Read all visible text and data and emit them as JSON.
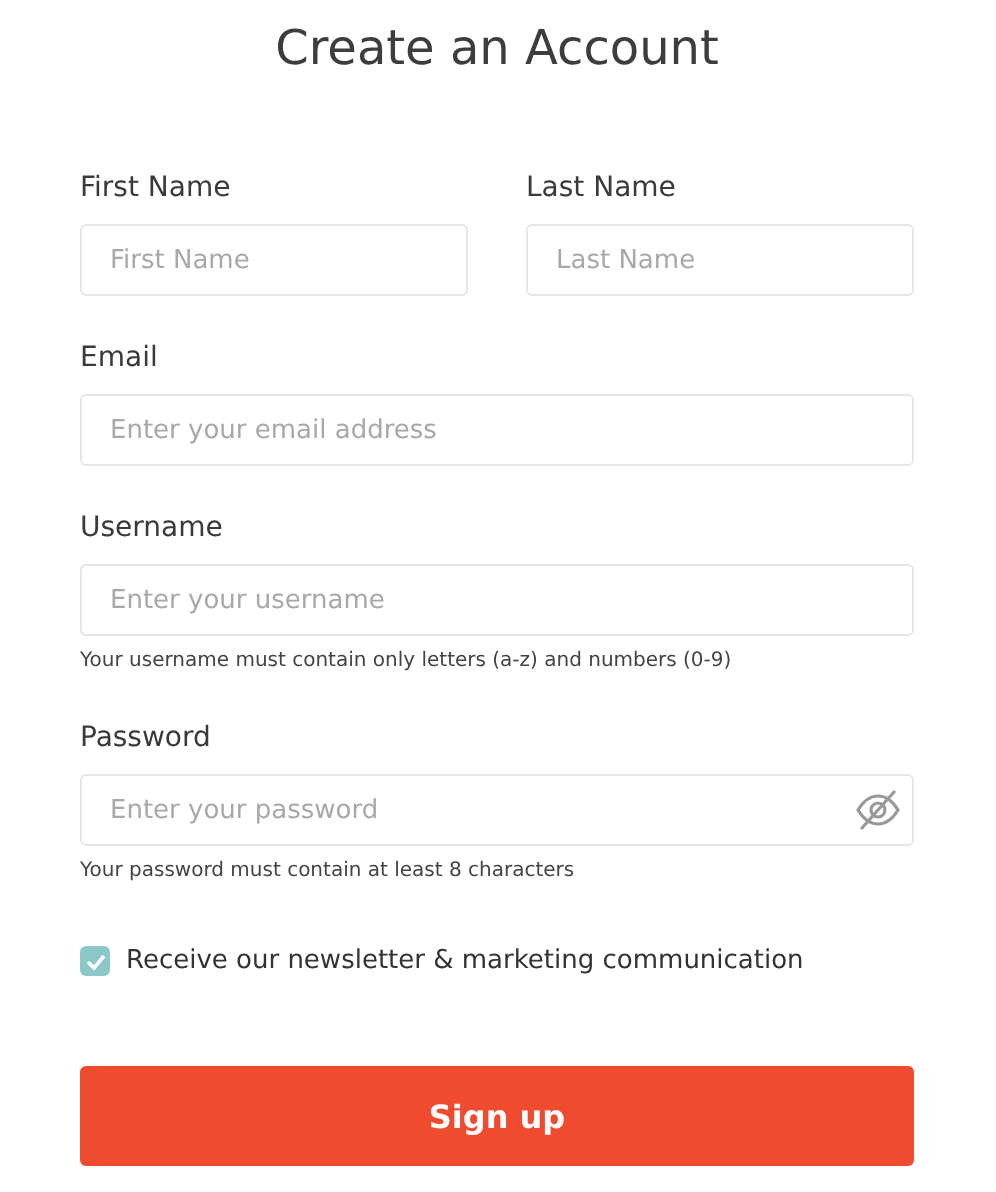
{
  "title": "Create an Account",
  "name_fields": [
    {
      "label": "First Name",
      "placeholder": "First Name"
    },
    {
      "label": "Last Name",
      "placeholder": "Last Name"
    }
  ],
  "fields": [
    {
      "label": "Email",
      "placeholder": "Enter your email address"
    },
    {
      "label": "Username",
      "placeholder": "Enter your username",
      "hint": "Your username must contain only letters (a-z) and numbers (0-9)"
    },
    {
      "label": "Password",
      "placeholder": "Enter your password",
      "hint": "Your password must contain at least 8 characters",
      "password_visible": false
    }
  ],
  "newsletter": {
    "label": "Receive our newsletter & marketing communication",
    "checked": true
  },
  "submit": {
    "label": "Sign up"
  }
}
